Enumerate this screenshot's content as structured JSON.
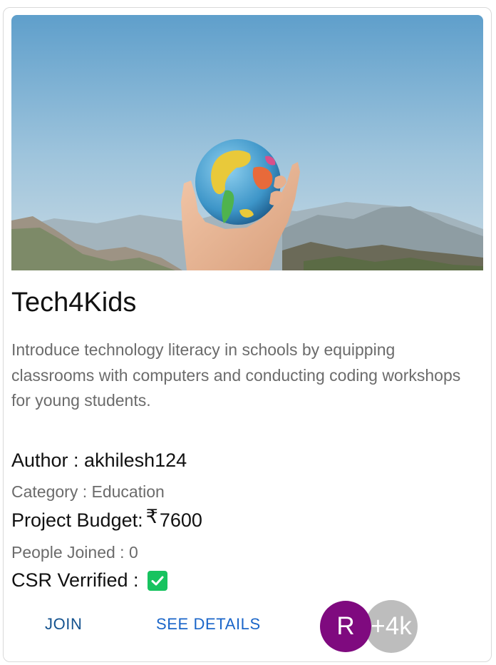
{
  "project": {
    "title": "Tech4Kids",
    "description": "Introduce technology literacy in schools by equipping classrooms with computers and conducting coding workshops for young students.",
    "author_label": "Author : akhilesh124",
    "category_label": "Category : Education",
    "budget_prefix": "Project Budget:",
    "currency_symbol": "₹",
    "budget_value": "7600",
    "people_joined_label": "People Joined : 0",
    "csr_label": "CSR Verrified :",
    "csr_verified": true
  },
  "actions": {
    "join_label": "JOIN",
    "details_label": "SEE DETAILS"
  },
  "members": {
    "first_initial": "R",
    "more_count": "+4k"
  },
  "colors": {
    "accent_link": "#1b66c9",
    "avatar_bg": "#7f0a7f",
    "more_bg": "#bdbdbd",
    "check_bg": "#17c35f"
  },
  "image": {
    "subject": "hand-holding-globe-photo"
  }
}
